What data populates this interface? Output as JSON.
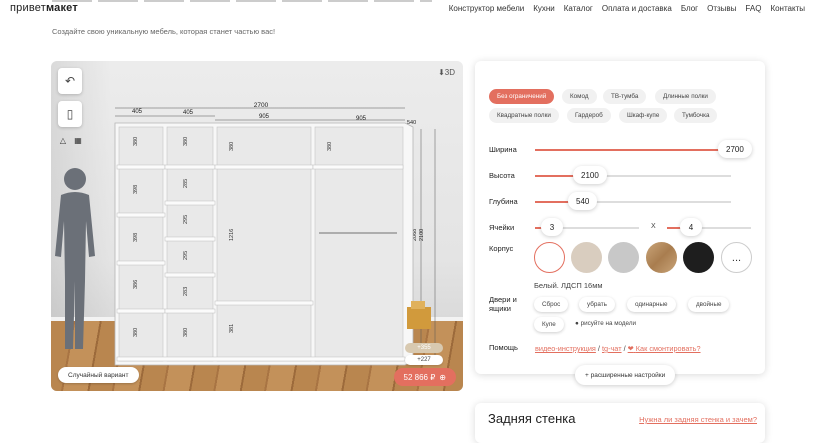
{
  "header": {
    "logo_light": "привет",
    "logo_bold": "макет",
    "nav": [
      "Конструктор мебели",
      "Кухни",
      "Каталог",
      "Оплата и доставка",
      "Блог",
      "Отзывы",
      "FAQ",
      "Контакты"
    ]
  },
  "subtitle": "Создайте свою уникальную мебель, которая станет частью вас!",
  "scene": {
    "view_label": "3D",
    "random_button": "Случайный вариант",
    "price": "52 866 ₽",
    "addon_a": "+355",
    "addon_b": "+227",
    "dims": {
      "total_width": "2700",
      "col1": "405",
      "col2": "405",
      "col3": "905",
      "col4": "905",
      "depth": "540",
      "height_outer": "2100",
      "height_inner": "2068",
      "shelf_380": "380",
      "shelf_285": "285",
      "shelf_295": "295",
      "shelf_398": "398",
      "shelf_386": "386",
      "shelf_283": "283",
      "rod": "1216",
      "shelf_381": "381"
    }
  },
  "presets": [
    "Без ограничений",
    "Комод",
    "ТВ-тумба",
    "Длинные полки",
    "Квадратные полки",
    "Гардероб",
    "Шкаф-купе",
    "Тумбочка"
  ],
  "params": {
    "width_label": "Ширина",
    "width_value": "2700",
    "height_label": "Высота",
    "height_value": "2100",
    "depth_label": "Глубина",
    "depth_value": "540",
    "cells_label": "Ячейки",
    "cells_x": "3",
    "cells_sep": "X",
    "cells_y": "4",
    "body_label": "Корпус",
    "body_caption": "Белый. ЛДСП 16мм",
    "more_icon": "..."
  },
  "swatch_colors": [
    "#ffffff",
    "#d9cdbf",
    "#c8c8c8",
    "#c9a57a",
    "#1e1e1e"
  ],
  "doors": {
    "label": "Двери и ящики",
    "options": [
      "Сброс",
      "убрать",
      "одинарные",
      "двойные",
      "Купе"
    ],
    "hint": "рисуйте на модели"
  },
  "help": {
    "label": "Помощь",
    "video": "видео-инструкция",
    "sep": "/",
    "tg": "tg-чат",
    "sep2": "/",
    "assemble": "Как смонтировать?"
  },
  "advanced_button": "+ расширенные настройки",
  "back_wall": {
    "title": "Задняя стенка",
    "link": "Нужна ли задняя стенка и зачем?"
  },
  "accent_color": "#e36f5f"
}
